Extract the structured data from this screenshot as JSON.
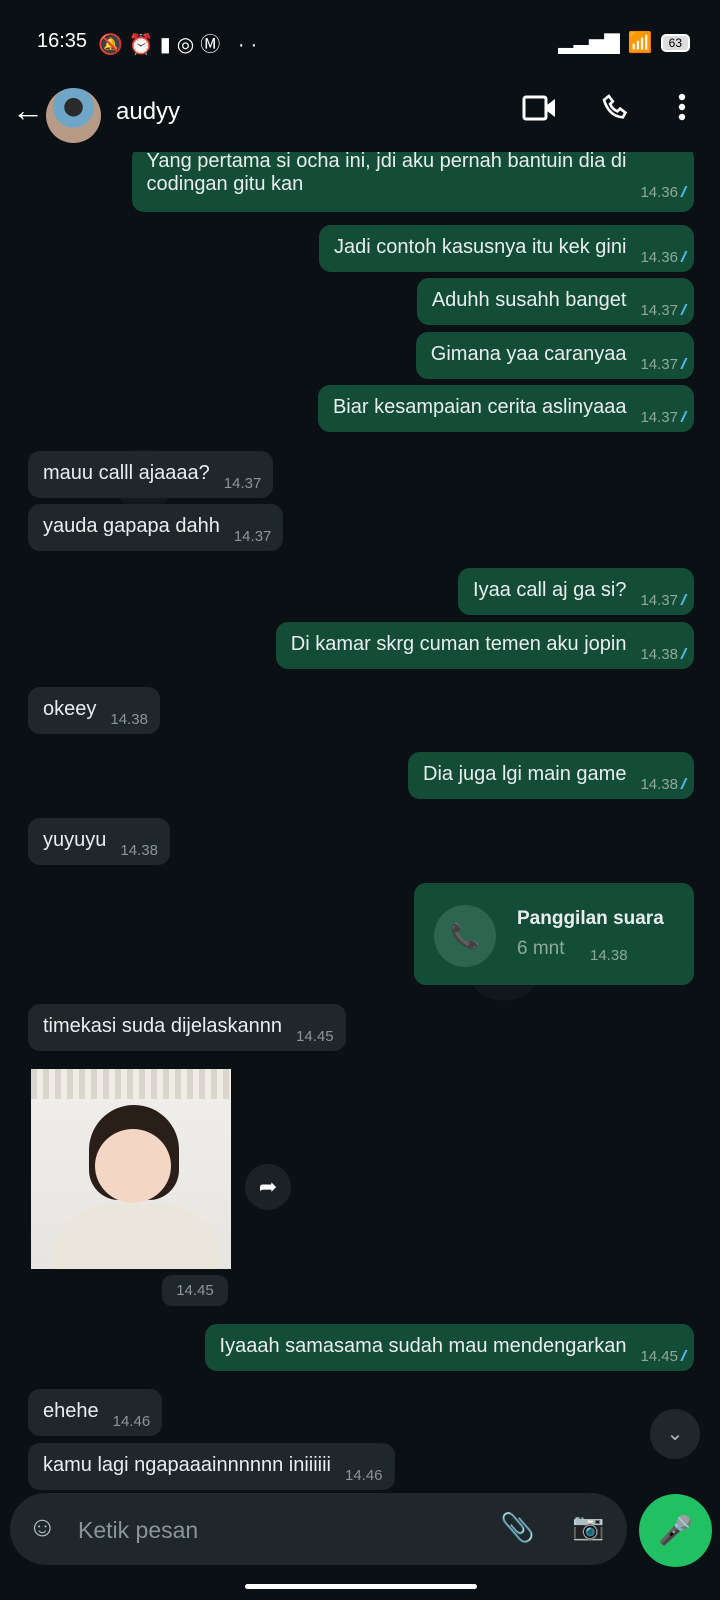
{
  "status": {
    "time": "16:35",
    "battery": "63"
  },
  "header": {
    "contact": "audyy"
  },
  "messages": [
    {
      "dir": "out",
      "text": "Yang pertama si ocha ini, jdi aku pernah bantuin dia di",
      "text2": "codingan gitu kan",
      "time": "14.36",
      "read": true
    },
    {
      "dir": "out",
      "text": "Jadi contoh kasusnya itu kek gini",
      "time": "14.36",
      "read": true
    },
    {
      "dir": "out",
      "text": "Aduhh susahh banget",
      "time": "14.37",
      "read": true
    },
    {
      "dir": "out",
      "text": "Gimana yaa caranyaa",
      "time": "14.37",
      "read": true
    },
    {
      "dir": "out",
      "text": "Biar kesampaian cerita aslinyaaa",
      "time": "14.37",
      "read": true
    },
    {
      "dir": "in",
      "text": "mauu calll ajaaaa?",
      "time": "14.37"
    },
    {
      "dir": "in",
      "text": "yauda gapapa dahh",
      "time": "14.37"
    },
    {
      "dir": "out",
      "text": "Iyaa call aj ga si?",
      "time": "14.37",
      "read": true
    },
    {
      "dir": "out",
      "text": "Di kamar skrg cuman temen aku jopin",
      "time": "14.38",
      "read": true
    },
    {
      "dir": "in",
      "text": "okeey",
      "time": "14.38"
    },
    {
      "dir": "out",
      "text": "Dia juga lgi main game",
      "time": "14.38",
      "read": true
    },
    {
      "dir": "in",
      "text": "yuyuyu",
      "time": "14.38"
    },
    {
      "dir": "in",
      "text": "timekasi suda dijelaskannn",
      "time": "14.45"
    },
    {
      "dir": "out",
      "text": "Iyaaah samasama sudah mau mendengarkan",
      "time": "14.45",
      "read": true
    },
    {
      "dir": "in",
      "text": "ehehe",
      "time": "14.46"
    },
    {
      "dir": "in",
      "text": "kamu lagi ngapaaainnnnnn iniiiiii",
      "time": "14.46"
    }
  ],
  "call": {
    "title": "Panggilan suara",
    "duration": "6 mnt",
    "time": "14.38"
  },
  "image_message": {
    "time": "14.45"
  },
  "composer": {
    "placeholder": "Ketik pesan"
  }
}
